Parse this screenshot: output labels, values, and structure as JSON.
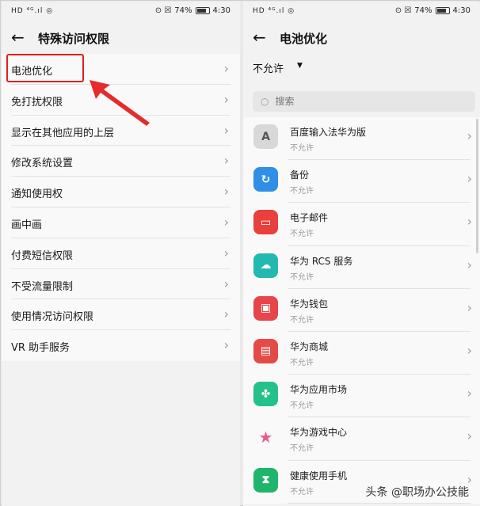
{
  "status": {
    "left_icons": "HD ⁴ᴳ.ıl ◎",
    "battery": "74%",
    "time": "4:30",
    "icons": "⊙ ☒"
  },
  "left": {
    "back_icon": "←",
    "title": "特殊访问权限",
    "items": [
      {
        "label": "电池优化"
      },
      {
        "label": "免打扰权限"
      },
      {
        "label": "显示在其他应用的上层"
      },
      {
        "label": "修改系统设置"
      },
      {
        "label": "通知使用权"
      },
      {
        "label": "画中画"
      },
      {
        "label": "付费短信权限"
      },
      {
        "label": "不受流量限制"
      },
      {
        "label": "使用情况访问权限"
      },
      {
        "label": "VR 助手服务"
      }
    ]
  },
  "right": {
    "back_icon": "←",
    "title": "电池优化",
    "filter_value": "不允许",
    "filter_caret": "▼",
    "search_placeholder": "搜索",
    "apps": [
      {
        "name": "百度输入法华为版",
        "status": "不允许",
        "icon_text": "A",
        "color": "#d8d8d8",
        "fg": "#555"
      },
      {
        "name": "备份",
        "status": "不允许",
        "icon_text": "↻",
        "color": "#2f8ee6",
        "fg": "#fff"
      },
      {
        "name": "电子邮件",
        "status": "不允许",
        "icon_text": "▭",
        "color": "#e9403d",
        "fg": "#fff"
      },
      {
        "name": "华为 RCS 服务",
        "status": "不允许",
        "icon_text": "☁",
        "color": "#23b9b0",
        "fg": "#fff"
      },
      {
        "name": "华为钱包",
        "status": "不允许",
        "icon_text": "▣",
        "color": "#e8454b",
        "fg": "#fff"
      },
      {
        "name": "华为商城",
        "status": "不允许",
        "icon_text": "▤",
        "color": "#e54b46",
        "fg": "#fff"
      },
      {
        "name": "华为应用市场",
        "status": "不允许",
        "icon_text": "✤",
        "color": "#25c18a",
        "fg": "#fff"
      },
      {
        "name": "华为游戏中心",
        "status": "不允许",
        "icon_text": "★",
        "color": "#f9f9f9",
        "fg": "#e85d8a"
      },
      {
        "name": "健康使用手机",
        "status": "不允许",
        "icon_text": "⧗",
        "color": "#1fb56b",
        "fg": "#fff"
      }
    ]
  },
  "chevron": "›",
  "search_icon": "○",
  "watermark": "头条 @职场办公技能",
  "colors": {
    "highlight": "#e02020"
  }
}
